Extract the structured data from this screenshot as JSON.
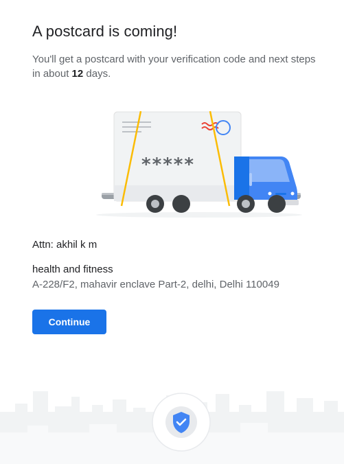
{
  "header": {
    "title": "A postcard is coming!",
    "subtitle_before": "You'll get a postcard with your verification code and next steps in about ",
    "subtitle_days": "12",
    "subtitle_after": " days."
  },
  "illustration": {
    "code_mask": "*****"
  },
  "address": {
    "attn": "Attn: akhil k m",
    "business_name": "health and fitness",
    "line": "A-228/F2, mahavir enclave Part-2, delhi, Delhi 110049"
  },
  "actions": {
    "continue_label": "Continue"
  },
  "colors": {
    "primary": "#1a73e8",
    "title_text": "#202124",
    "secondary_text": "#5f6368",
    "strap": "#fbbc04",
    "truck_cab": "#4285f4"
  },
  "icons": {
    "badge": "shield-check-icon"
  }
}
